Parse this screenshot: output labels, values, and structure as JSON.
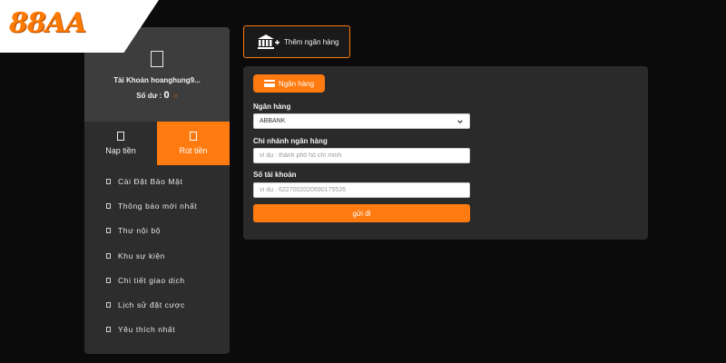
{
  "logo": {
    "text": "88AA"
  },
  "sidebar": {
    "account_label": "Tài Khoản hoanghung9...",
    "balance_label": "Số dư :",
    "balance_amount": "0",
    "balance_currency": "○",
    "tabs": [
      {
        "label": "Nạp tiền",
        "active": false
      },
      {
        "label": "Rút tiền",
        "active": true
      }
    ],
    "menu": [
      {
        "label": "Cài Đặt Bảo Mật"
      },
      {
        "label": "Thông báo mới nhất"
      },
      {
        "label": "Thư nội bộ"
      },
      {
        "label": "Khu sự kiện"
      },
      {
        "label": "Chi tiết giao dịch"
      },
      {
        "label": "Lịch sử đặt cược"
      },
      {
        "label": "Yêu thích nhất"
      }
    ]
  },
  "add_bank": {
    "label": "Thêm ngân hàng"
  },
  "form": {
    "tab_label": "Ngân hàng",
    "bank_label": "Ngân hàng",
    "bank_value": "ABBANK",
    "branch_label": "Chi nhánh ngân hàng",
    "branch_placeholder": "ví dụ : thành phố hồ chí minh",
    "account_label": "Số tài khoản",
    "account_placeholder": "ví dụ : 6227002020690175526",
    "submit_label": "gửi đi"
  },
  "colors": {
    "accent": "#ff7a0f",
    "background": "#0b0b0b",
    "panel": "#2a2a2a"
  }
}
